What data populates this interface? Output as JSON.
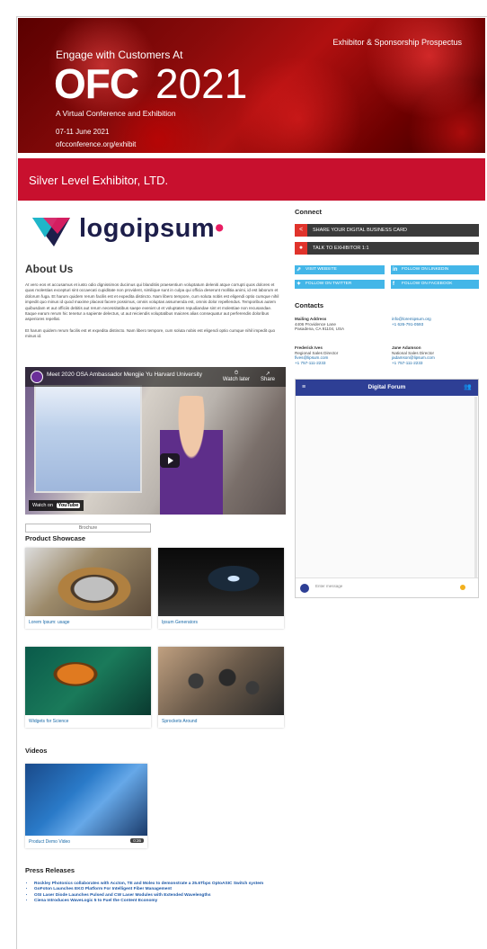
{
  "banner": {
    "prospectus": "Exhibitor & Sponsorship Prospectus",
    "engage": "Engage with Customers At",
    "ofc": "OFC",
    "year": "2021",
    "tagline": "A Virtual Conference and Exhibition",
    "dates": "07-11 June 2021",
    "url": "ofcconference.org/exhibit"
  },
  "exhibitor": {
    "name": "Silver Level Exhibitor, LTD."
  },
  "logo": {
    "text": "logoipsum",
    "dot": "•"
  },
  "about": {
    "title": "About Us",
    "paragraph1": "At vero eos et accusamus et iusto odio dignissimos ducimus qui blanditiis praesentium voluptatum deleniti atque corrupti quos dolores et quas molestias excepturi sint occaecati cupiditate non provident, similique sunt in culpa qui officia deserunt mollitia animi, id est laborum et dolorum fuga. Et harum quidem rerum facilis est et expedita distincto. Nam libero tempore, cum soluta nobis est eligendi optio cumque nihil impedit quo minus id quod maxime placeat facere possimus, omnis voluptas assumenda est, omnis dolor repellendus. Temporibus autem quibusdam et aut officiis debitis aut rerum necessitatibus saepe eveniet ut et voluptates repudiandae sint et molestiae non recusandae. Itaque earum rerum hic tenetur a sapiente delectus, ut aut reiciendis voluptatibus maiores alias consequatur aut perferendis doloribus asperiores repellat.",
    "paragraph2": "Et harum quidem rerum facilis est et expedita distincto. Nam libero tempore, cum soluta nobis est eligendi optio cumque nihil impedit quo minus id."
  },
  "video": {
    "title": "Meet 2020 OSA Ambassador Mengjie Yu Harvard University",
    "watch_later": "Watch later",
    "share": "Share",
    "watch_on": "Watch on",
    "youtube": "YouTube"
  },
  "brochure": {
    "label": "Brochure"
  },
  "showcase": {
    "title": "Product Showcase",
    "items": [
      {
        "caption": "Lorem Ipsum: usage"
      },
      {
        "caption": "Ipsum Generators"
      },
      {
        "caption": "Widgets for Science"
      },
      {
        "caption": "Sprockets Around"
      }
    ]
  },
  "videos": {
    "title": "Videos",
    "item": {
      "caption": "Product Demo Video",
      "duration": "0:36"
    }
  },
  "press": {
    "title": "Press Releases",
    "items": [
      "Rockley Photonics collaborates with Accton, TE and Molex to demonstrate a 25.6Tbps OptoASIC Switch system",
      "GoFoton Launches EKO Platform For Intelligent Fiber Management",
      "OSI Laser Diode Launches Pulsed and CW Laser Modules with Extended Wavelengths",
      "Ciena Introduces WaveLogic 5 to Fuel the Content Economy"
    ]
  },
  "connect": {
    "title": "Connect",
    "share_card": "SHARE YOUR DIGITAL BUSINESS CARD",
    "talk": "TALK TO EXHIBITOR 1:1",
    "visit": "VISIT WEBSITE",
    "linkedin": "FOLLOW ON LINKEDIN",
    "twitter": "FOLLOW ON TWITTER",
    "facebook": "FOLLOW ON FACEBOOK"
  },
  "contacts": {
    "title": "Contacts",
    "mailing": {
      "label": "Mailing Address",
      "line1": "4406 Providence Lane",
      "line2": "Pasadena, CA 91104, USA"
    },
    "general": {
      "email": "info@loremipsum.org",
      "phone": "+1 626-791-0593"
    },
    "person1": {
      "name": "Frederick Ives",
      "role": "Regional Sales Director",
      "email": "fives@lipsum.com",
      "phone": "+1 757-111-2233"
    },
    "person2": {
      "name": "Jane Adamson",
      "role": "National Sales Director",
      "email": "jadamson@lipsum.com",
      "phone": "+1 757-111-2233"
    }
  },
  "forum": {
    "title": "Digital Forum",
    "placeholder": "Enter message"
  },
  "colors": {
    "banner_red": "#c8102e",
    "forum_blue": "#2e3f95",
    "social_blue": "#43b6e8",
    "action_red": "#e0332b"
  }
}
